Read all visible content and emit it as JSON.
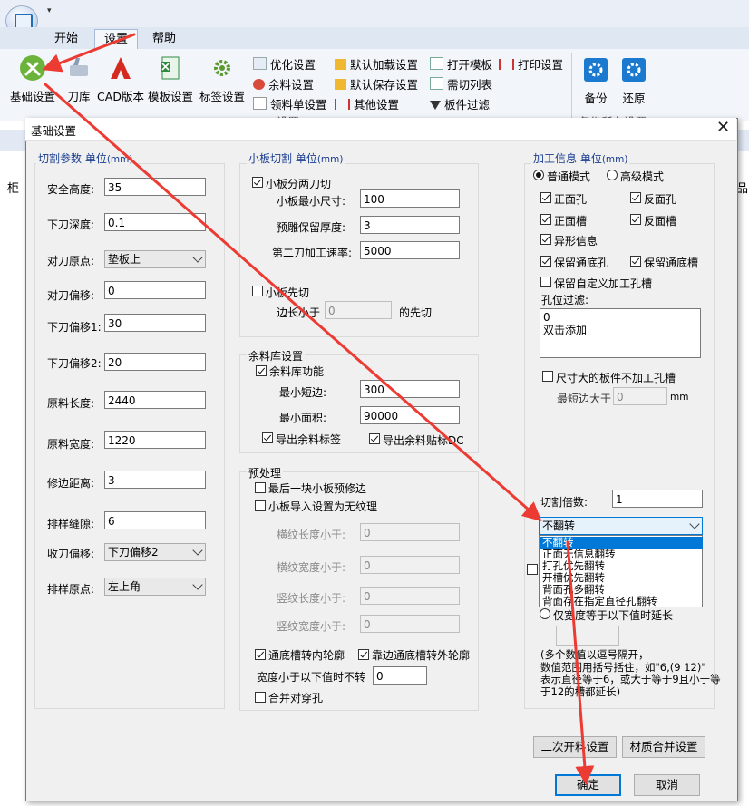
{
  "app": {
    "qat_arrow": "▾"
  },
  "tabs": [
    {
      "label": "开始"
    },
    {
      "label": "设置"
    },
    {
      "label": "帮助"
    }
  ],
  "ribbon": {
    "big_buttons": [
      {
        "label": "基础设置",
        "icon": "wrench-screwdriver-icon"
      },
      {
        "label": "刀库",
        "icon": "tool-library-icon"
      },
      {
        "label": "CAD版本",
        "icon": "cad-icon"
      },
      {
        "label": "模板设置",
        "icon": "excel-template-icon"
      },
      {
        "label": "标签设置",
        "icon": "gear-label-icon"
      }
    ],
    "small_buttons": [
      {
        "label": "优化设置"
      },
      {
        "label": "余料设置"
      },
      {
        "label": "领料单设置"
      },
      {
        "label": "默认加载设置"
      },
      {
        "label": "默认保存设置"
      },
      {
        "label": "其他设置"
      },
      {
        "label": "打开模板"
      },
      {
        "label": "需切列表"
      },
      {
        "label": "板件过滤"
      },
      {
        "label": "打印设置"
      }
    ],
    "group_partial_1": "设置",
    "backup": {
      "label": "备份"
    },
    "restore": {
      "label": "还原"
    },
    "group_partial_2": "备份所有设置"
  },
  "background": {
    "left_text": "柜",
    "right_text": "品"
  },
  "dialog": {
    "title": "基础设置",
    "close": "✕",
    "cutting": {
      "title": "切割参数 单位",
      "unit": "(mm)",
      "fields": [
        {
          "label": "安全高度:",
          "value": "35"
        },
        {
          "label": "下刀深度:",
          "value": "0.1"
        },
        {
          "label": "对刀偏移:",
          "value": "0"
        },
        {
          "label": "下刀偏移1:",
          "value": "30"
        },
        {
          "label": "下刀偏移2:",
          "value": "20"
        },
        {
          "label": "原料长度:",
          "value": "2440"
        },
        {
          "label": "原料宽度:",
          "value": "1220"
        },
        {
          "label": "修边距离:",
          "value": "3"
        },
        {
          "label": "排样缝隙:",
          "value": "6"
        }
      ],
      "origin": {
        "label": "对刀原点:",
        "value": "垫板上"
      },
      "retract": {
        "label": "收刀偏移:",
        "value": "下刀偏移2"
      },
      "layout_origin": {
        "label": "排样原点:",
        "value": "左上角"
      }
    },
    "small_board": {
      "title": "小板切割 单位",
      "unit": "(mm)",
      "two_pass": "小板分两刀切",
      "min_size": {
        "label": "小板最小尺寸:",
        "value": "100"
      },
      "keep_thickness": {
        "label": "预雕保留厚度:",
        "value": "3"
      },
      "second_speed": {
        "label": "第二刀加工速率:",
        "value": "5000"
      },
      "cut_first": "小板先切",
      "edge_prefix": "边长小于",
      "edge_value": "0",
      "edge_suffix": "的先切"
    },
    "remnant": {
      "title": "余料库设置",
      "enable": "余料库功能",
      "min_short": {
        "label": "最小短边:",
        "value": "300"
      },
      "min_area": {
        "label": "最小面积:",
        "value": "90000"
      },
      "export_label": "导出余料标签",
      "export_sticker": "导出余料贴标DC"
    },
    "preprocess": {
      "title": "预处理",
      "last_trim": "最后一块小板预修边",
      "no_grain": "小板导入设置为无纹理",
      "h_len": {
        "label": "横纹长度小于:",
        "value": "0"
      },
      "h_wid": {
        "label": "横纹宽度小于:",
        "value": "0"
      },
      "v_len": {
        "label": "竖纹长度小于:",
        "value": "0"
      },
      "v_wid": {
        "label": "竖纹宽度小于:",
        "value": "0"
      },
      "groove_inner": "通底槽转内轮廓",
      "groove_outer": "靠边通底槽转外轮廓",
      "no_rotate": {
        "label": "宽度小于以下值时不转",
        "value": "0"
      },
      "merge_holes": "合并对穿孔"
    },
    "process": {
      "title": "加工信息 单位",
      "unit": "(mm)",
      "mode_normal": "普通模式",
      "mode_advanced": "高级模式",
      "front_hole": "正面孔",
      "back_hole": "反面孔",
      "front_slot": "正面槽",
      "back_slot": "反面槽",
      "odd_shape": "异形信息",
      "keep_through_hole": "保留通底孔",
      "keep_through_slot": "保留通底槽",
      "keep_custom": "保留自定义加工孔槽",
      "hole_filter_label": "孔位过滤:",
      "hole_filter_text": "0\n双击添加",
      "large_board": "尺寸大的板件不加工孔槽",
      "min_short_label": "最短边大于",
      "min_short_value": "0",
      "min_short_unit": "mm",
      "cut_multiple": {
        "label": "切割倍数:",
        "value": "1"
      },
      "flip_selected": "不翻转",
      "flip_options": [
        "不翻转",
        "正面无信息翻转",
        "打孔优先翻转",
        "开槽优先翻转",
        "背面孔多翻转",
        "背面存在指定直径孔翻转"
      ],
      "extend_label": "仅宽度等于以下值时延长",
      "note": "(多个数值以逗号隔开，\n数值范围用括号括住，如\"6,(9 12)\"\n表示直径等于6，或大于等于9且小于等\n于12的槽都延长)"
    },
    "buttons": {
      "secondary_open": "二次开料设置",
      "material_merge": "材质合并设置",
      "ok": "确定",
      "cancel": "取消"
    }
  }
}
